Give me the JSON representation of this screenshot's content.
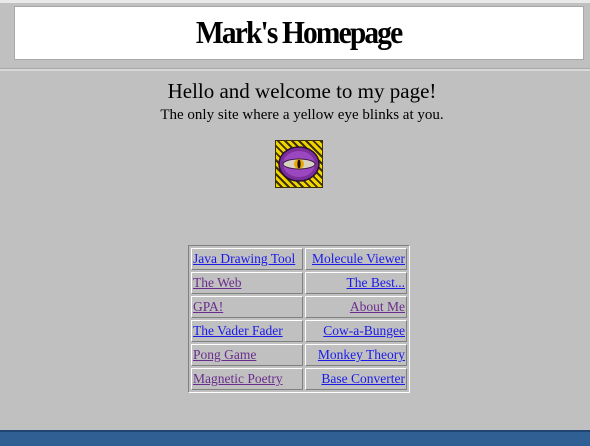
{
  "banner": {
    "title": "Mark's Homepage"
  },
  "welcome": {
    "heading": "Hello and welcome to my page!",
    "tagline": "The only site where a yellow eye blinks at you."
  },
  "eye_image": {
    "icon": "yellow-eye-icon"
  },
  "links": [
    {
      "left": {
        "label": "Java Drawing Tool",
        "visited": false
      },
      "right": {
        "label": "Molecule Viewer",
        "visited": false
      }
    },
    {
      "left": {
        "label": "The Web",
        "visited": true
      },
      "right": {
        "label": "The Best...",
        "visited": false
      }
    },
    {
      "left": {
        "label": "GPA!",
        "visited": true
      },
      "right": {
        "label": "About Me",
        "visited": true
      }
    },
    {
      "left": {
        "label": "The Vader Fader",
        "visited": false
      },
      "right": {
        "label": "Cow-a-Bungee",
        "visited": false
      }
    },
    {
      "left": {
        "label": "Pong Game",
        "visited": true
      },
      "right": {
        "label": "Monkey Theory",
        "visited": false
      }
    },
    {
      "left": {
        "label": "Magnetic Poetry",
        "visited": true
      },
      "right": {
        "label": "Base Converter",
        "visited": false
      }
    }
  ],
  "colors": {
    "page_background": "#c0c0c0",
    "link_unvisited": "#1a1ae8",
    "link_visited": "#6a2c8c",
    "footer_bar": "#2f5f93"
  }
}
